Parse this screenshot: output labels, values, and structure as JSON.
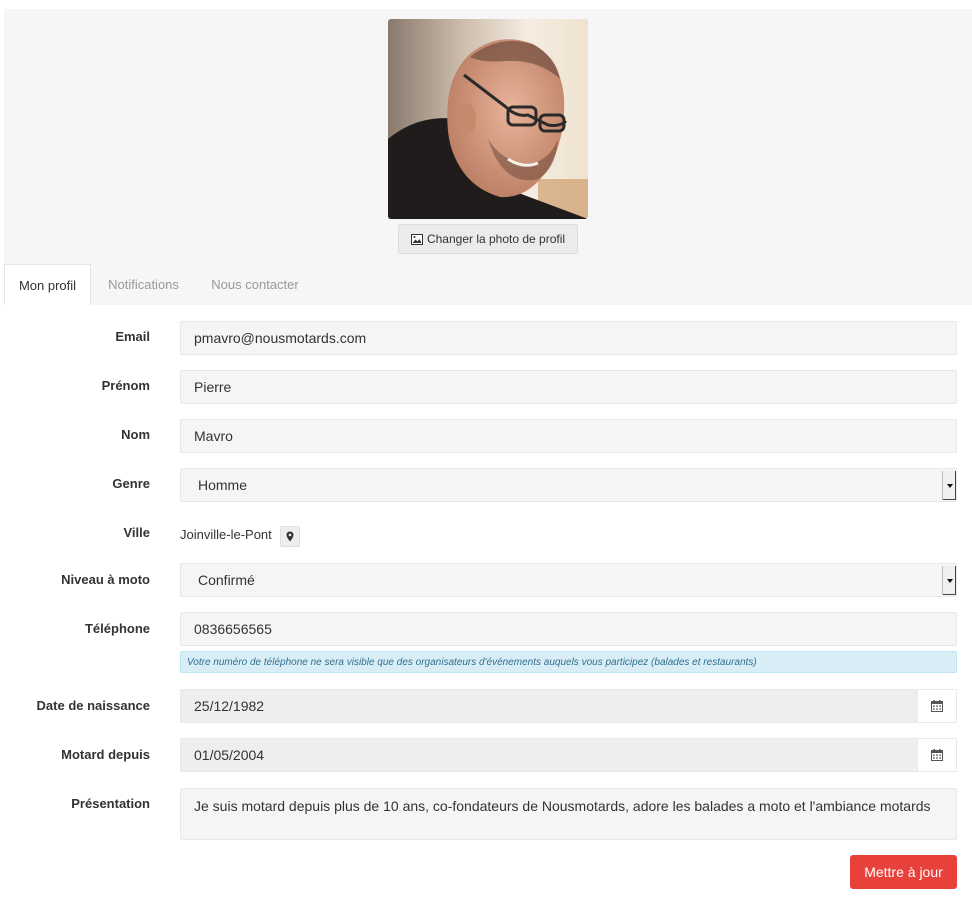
{
  "profile": {
    "change_photo_label": "Changer la photo de profil"
  },
  "tabs": [
    {
      "label": "Mon profil",
      "active": true
    },
    {
      "label": "Notifications",
      "active": false
    },
    {
      "label": "Nous contacter",
      "active": false
    }
  ],
  "form": {
    "email": {
      "label": "Email",
      "value": "pmavro@nousmotards.com"
    },
    "prenom": {
      "label": "Prénom",
      "value": "Pierre"
    },
    "nom": {
      "label": "Nom",
      "value": "Mavro"
    },
    "genre": {
      "label": "Genre",
      "value": "Homme"
    },
    "ville": {
      "label": "Ville",
      "value": "Joinville-le-Pont",
      "icon": "map-marker-icon"
    },
    "niveau": {
      "label": "Niveau à moto",
      "value": "Confirmé"
    },
    "telephone": {
      "label": "Téléphone",
      "value": "0836656565",
      "note": "Votre numéro de téléphone ne sera visible que des organisateurs d'événements auquels vous participez (balades et restaurants)"
    },
    "naissance": {
      "label": "Date de naissance",
      "value": "25/12/1982",
      "icon": "calendar-icon"
    },
    "motard_depuis": {
      "label": "Motard depuis",
      "value": "01/05/2004",
      "icon": "calendar-icon"
    },
    "presentation": {
      "label": "Présentation",
      "value": "Je suis motard depuis plus de 10 ans, co-fondateurs de Nousmotards, adore les balades a moto et l'ambiance motards"
    },
    "submit_label": "Mettre à jour"
  },
  "colors": {
    "accent": "#e8403a",
    "info_bg": "#d9edf7",
    "info_text": "#31708f"
  }
}
